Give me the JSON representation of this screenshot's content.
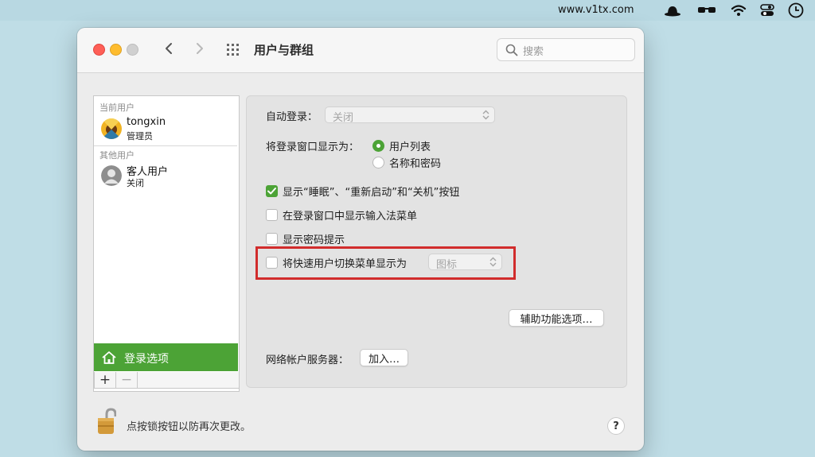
{
  "menubar": {
    "site": "www.v1tx.com",
    "icons": [
      "hat-icon",
      "glasses-icon",
      "wifi-icon",
      "control-center-icon",
      "clock-icon"
    ]
  },
  "window": {
    "title": "用户与群组",
    "search_placeholder": "搜索"
  },
  "sidebar": {
    "current_users_header": "当前用户",
    "other_users_header": "其他用户",
    "users": [
      {
        "name": "tongxin",
        "role": "管理员"
      },
      {
        "name": "客人用户",
        "role": "关闭"
      }
    ],
    "login_options": "登录选项",
    "add": "+",
    "remove": "−"
  },
  "panel": {
    "auto_login_label": "自动登录：",
    "auto_login_value": "关闭",
    "display_login_label": "将登录窗口显示为：",
    "radio_list": "用户列表",
    "radio_name_password": "名称和密码",
    "check_sleep": "显示“睡眠”、“重新启动”和“关机”按钮",
    "check_input_menu": "在登录窗口中显示输入法菜单",
    "check_password_hint": "显示密码提示",
    "check_fast_switch": "将快速用户切换菜单显示为",
    "fast_switch_value": "图标",
    "accessibility_button": "辅助功能选项…",
    "network_server_label": "网络帐户服务器：",
    "join_button": "加入…"
  },
  "footer": {
    "lock_text": "点按锁按钮以防再次更改。",
    "help": "?"
  },
  "colors": {
    "accent": "#4ca336",
    "highlight": "#d12c2c"
  }
}
